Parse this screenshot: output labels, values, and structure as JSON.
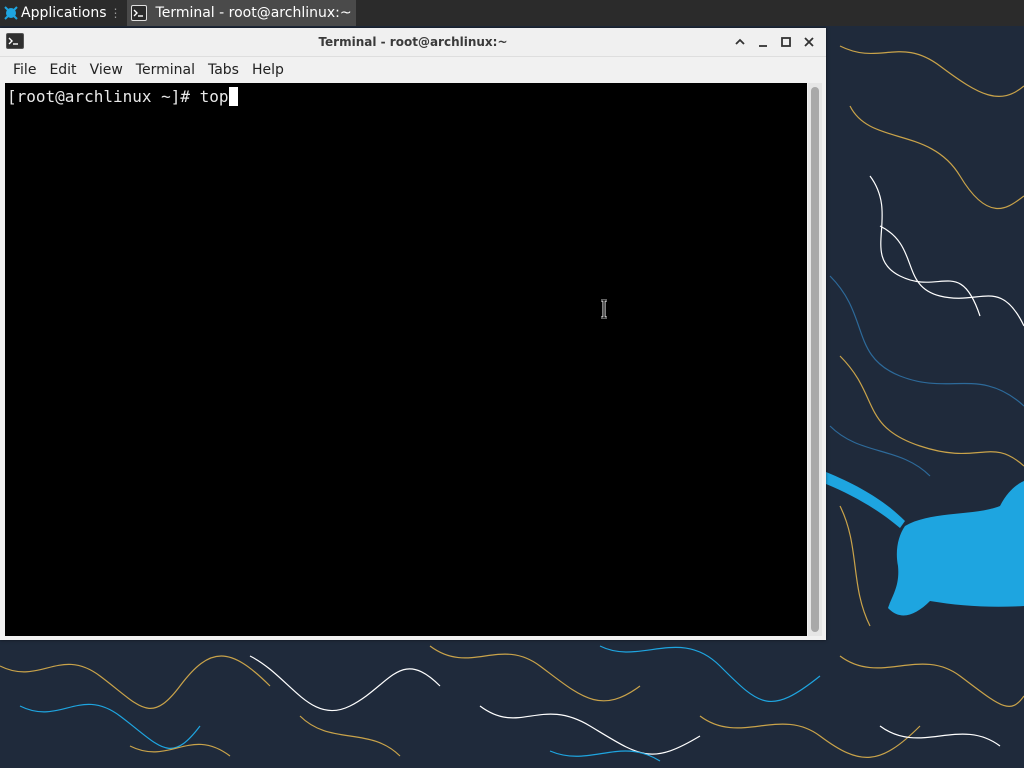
{
  "panel": {
    "applications_label": "Applications",
    "task_title": "Terminal - root@archlinux:~"
  },
  "window": {
    "title": "Terminal - root@archlinux:~",
    "menus": [
      "File",
      "Edit",
      "View",
      "Terminal",
      "Tabs",
      "Help"
    ]
  },
  "terminal": {
    "prompt": "[root@archlinux ~]# ",
    "command": "top"
  },
  "icons": {
    "applications": "xfce-mouse-icon",
    "task": "terminal-icon",
    "window": "terminal-icon",
    "controls": [
      "chevron-up-icon",
      "minimize-icon",
      "maximize-icon",
      "close-icon"
    ]
  },
  "colors": {
    "panel_bg": "#2b2b2b",
    "task_active_bg": "#4a4a4a",
    "desktop_bg": "#1f2a3b",
    "terminal_bg": "#000000",
    "terminal_fg": "#e8e8e8",
    "accent_blue": "#1ea5e0",
    "contour_yellow": "#c9a34a"
  }
}
